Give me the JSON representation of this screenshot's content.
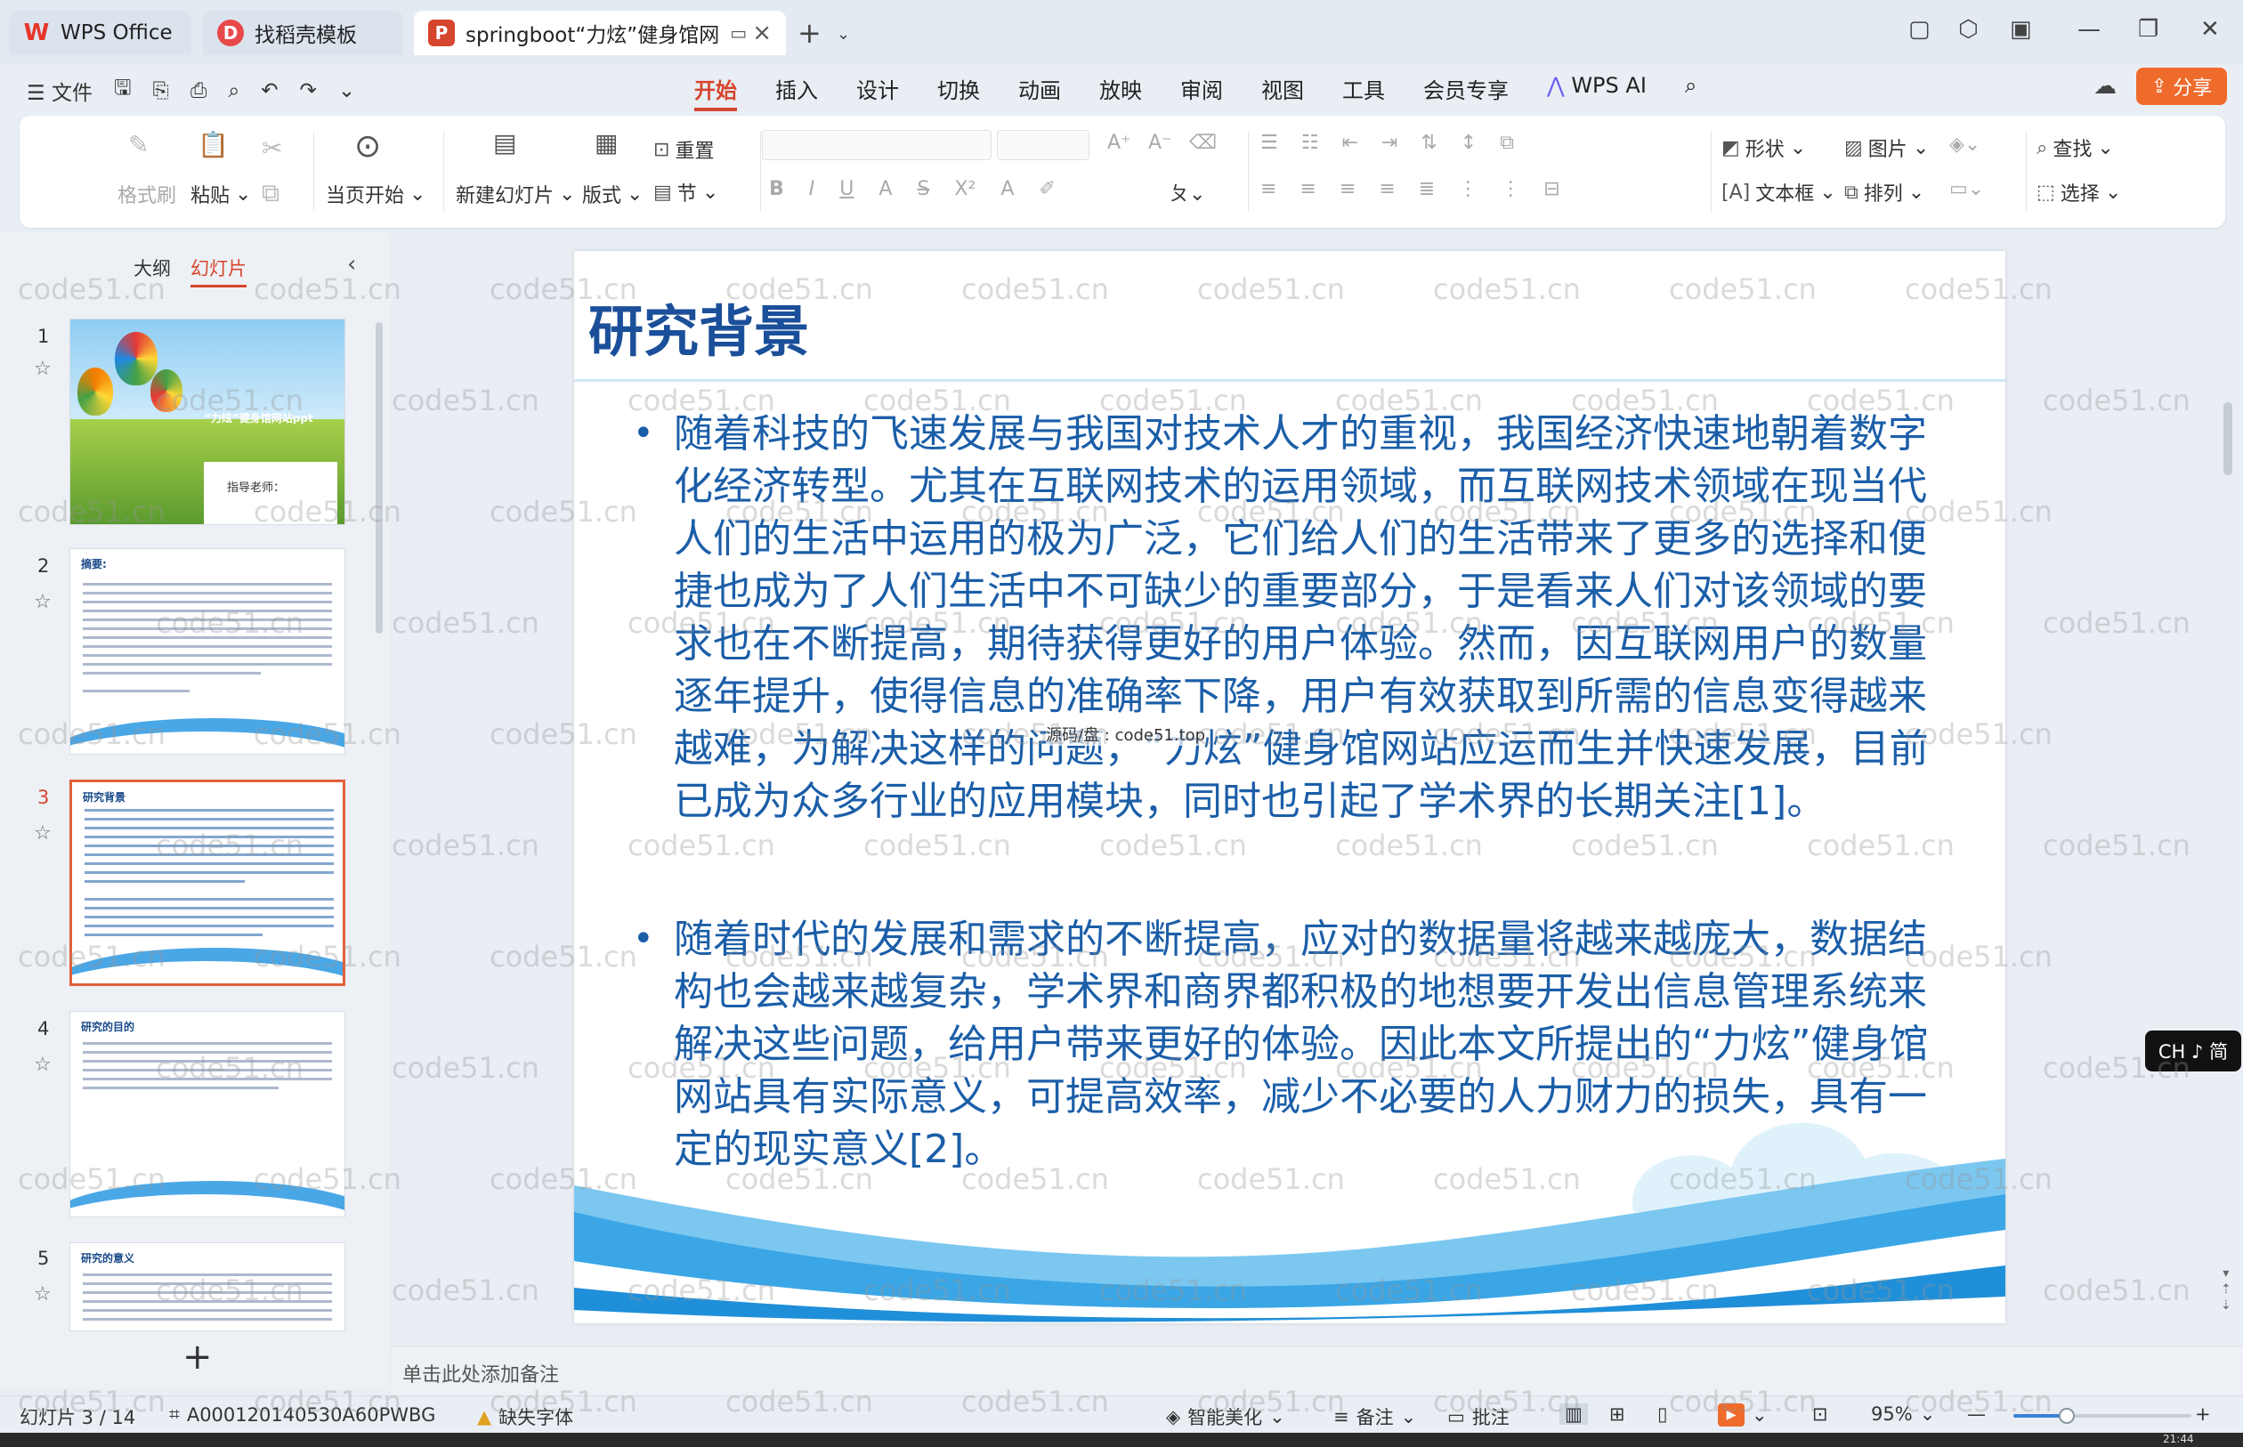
{
  "titlebar": {
    "tabs": [
      {
        "label": "WPS Office",
        "icon": "wps-logo-icon"
      },
      {
        "label": "找稻壳模板",
        "icon": "docer-icon"
      },
      {
        "label": "springboot“力炫”健身馆网",
        "icon": "ppt-file-icon"
      }
    ],
    "new_tab": "+"
  },
  "menubar": {
    "file_label": "文件",
    "tabs": [
      "开始",
      "插入",
      "设计",
      "切换",
      "动画",
      "放映",
      "审阅",
      "视图",
      "工具",
      "会员专享"
    ],
    "active_tab": "开始",
    "wps_ai": "WPS AI",
    "share": "分享"
  },
  "ribbon": {
    "format_painter": "格式刷",
    "paste": "粘贴",
    "play_from_current": "当页开始",
    "new_slide": "新建幻灯片",
    "layout": "版式",
    "reset": "重置",
    "section": "节",
    "shape": "形状",
    "picture": "图片",
    "textbox": "文本框",
    "arrange": "排列",
    "find": "查找",
    "select": "选择"
  },
  "leftpanel": {
    "tab_outline": "大纲",
    "tab_slides": "幻灯片",
    "add_slide": "+",
    "thumbnails": [
      {
        "num": "1",
        "title": "“力炫”健身馆网站ppt",
        "subtitle": "指导老师："
      },
      {
        "num": "2",
        "title": "摘要:"
      },
      {
        "num": "3",
        "title": "研究背景"
      },
      {
        "num": "4",
        "title": "研究的目的"
      },
      {
        "num": "5",
        "title": "研究的意义"
      }
    ],
    "active_index": 3
  },
  "slide": {
    "title": "研究背景",
    "bullets": [
      "随着科技的飞速发展与我国对技术人才的重视，我国经济快速地朝着数字化经济转型。尤其在互联网技术的运用领域，而互联网技术领域在现当代人们的生活中运用的极为广泛，它们给人们的生活带来了更多的选择和便捷也成为了人们生活中不可缺少的重要部分，于是看来人们对该领域的要求也在不断提高，期待获得更好的用户体验。然而，因互联网用户的数量逐年提升，使得信息的准确率下降，用户有效获取到所需的信息变得越来越难，为解决这样的问题，“力炫”健身馆网站应运而生并快速发展，目前已成为众多行业的应用模块，同时也引起了学术界的长期关注[1]。",
      "随着时代的发展和需求的不断提高，应对的数据量将越来越庞大，数据结构也会越来越复杂，学术界和商界都积极的地想要开发出信息管理系统来解决这些问题，给用户带来更好的体验。因此本文所提出的“力炫”健身馆网站具有实际意义，可提高效率，减少不必要的人力财力的损失，具有一定的现实意义[2]。"
    ],
    "credit": "源码/盘 : code51.top"
  },
  "notes_placeholder": "单击此处添加备注",
  "statusbar": {
    "slide_indicator": "幻灯片 3 / 14",
    "doc_id": "A000120140530A60PWBG",
    "missing_font": "缺失字体",
    "smart_beautify": "智能美化",
    "notes": "备注",
    "comments": "批注",
    "zoom": "95%",
    "zoom_fraction": 0.3
  },
  "ime": "CH ♪ 简",
  "taskbar_time": "21:44",
  "watermark": "code51.cn",
  "colors": {
    "accent": "#d6452d",
    "slide_text": "#1b5ea8",
    "slide_title": "#1b4f9a",
    "share_bg": "#ef6b2c"
  }
}
